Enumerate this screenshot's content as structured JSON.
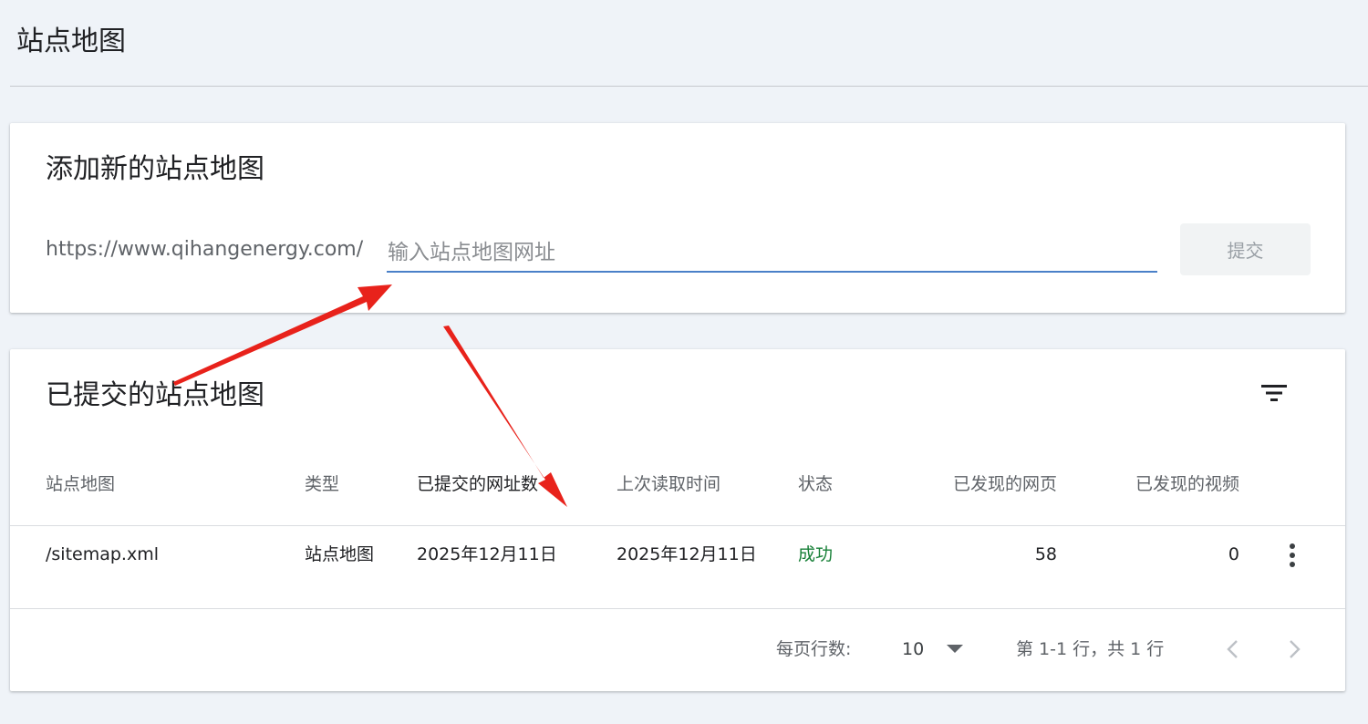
{
  "page": {
    "title": "站点地图"
  },
  "add_card": {
    "heading": "添加新的站点地图",
    "url_prefix": "https://www.qihangenergy.com/",
    "input_placeholder": "输入站点地图网址",
    "input_value": "",
    "submit_label": "提交"
  },
  "list_card": {
    "heading": "已提交的站点地图",
    "columns": {
      "sitemap": "站点地图",
      "type": "类型",
      "submitted_urls": "已提交的网址数",
      "last_read": "上次读取时间",
      "status": "状态",
      "discovered_pages": "已发现的网页",
      "discovered_videos": "已发现的视频"
    },
    "rows": [
      {
        "sitemap": "/sitemap.xml",
        "type": "站点地图",
        "submitted": "2025年12月11日",
        "last_read": "2025年12月11日",
        "status": "成功",
        "pages": "58",
        "videos": "0"
      }
    ],
    "pagination": {
      "rows_per_page_label": "每页行数:",
      "rows_per_page_value": "10",
      "range_label": "第 1-1 行，共 1 行"
    }
  },
  "colors": {
    "background": "#eff3f8",
    "input_underline": "#4a80c8",
    "status_success": "#188038",
    "annotation_arrow": "#e8221b"
  },
  "icons": {
    "filter": "filter-icon",
    "sort": "sort-arrow-down-icon",
    "more": "more-vertical-icon",
    "dropdown": "caret-down-icon",
    "prev": "chevron-left-icon",
    "next": "chevron-right-icon"
  }
}
